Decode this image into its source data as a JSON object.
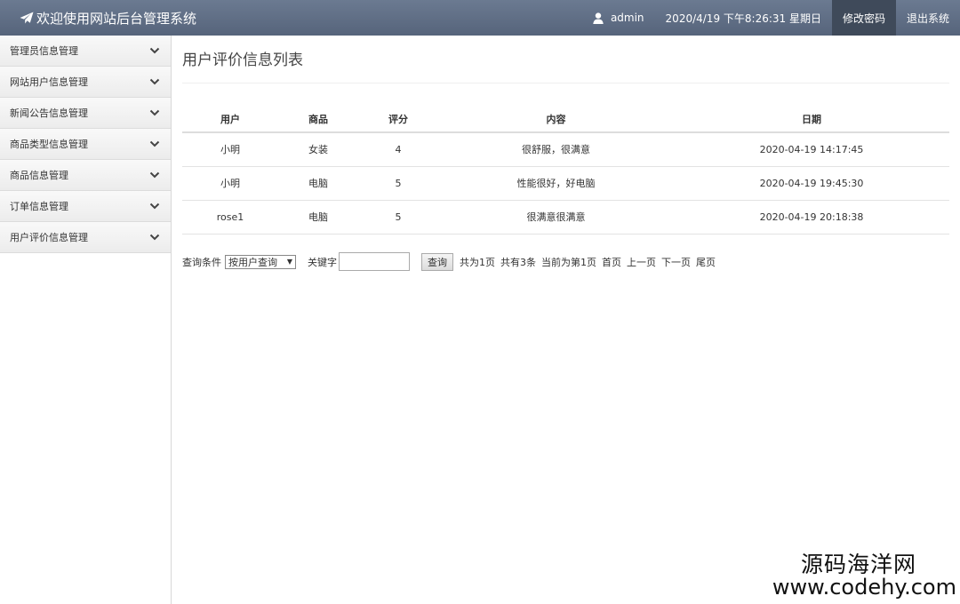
{
  "header": {
    "title": "欢迎使用网站后台管理系统",
    "user": "admin",
    "datetime": "2020/4/19 下午8:26:31 星期日",
    "change_password": "修改密码",
    "logout": "退出系统"
  },
  "sidebar": {
    "items": [
      {
        "label": "管理员信息管理"
      },
      {
        "label": "网站用户信息管理"
      },
      {
        "label": "新闻公告信息管理"
      },
      {
        "label": "商品类型信息管理"
      },
      {
        "label": "商品信息管理"
      },
      {
        "label": "订单信息管理"
      },
      {
        "label": "用户评价信息管理"
      }
    ]
  },
  "main": {
    "title": "用户评价信息列表",
    "columns": [
      "用户",
      "商品",
      "评分",
      "内容",
      "日期"
    ],
    "rows": [
      [
        "小明",
        "女装",
        "4",
        "很舒服，很满意",
        "2020-04-19 14:17:45"
      ],
      [
        "小明",
        "电脑",
        "5",
        "性能很好，好电脑",
        "2020-04-19 19:45:30"
      ],
      [
        "rose1",
        "电脑",
        "5",
        "很满意很满意",
        "2020-04-19 20:18:38"
      ]
    ],
    "search": {
      "condition_label": "查询条件",
      "condition_value": "按用户查询",
      "keyword_label": "关键字",
      "keyword_value": "",
      "query_button": "查询"
    },
    "pagination": {
      "total_pages": "共为1页",
      "total_records": "共有3条",
      "current": "当前为第1页",
      "first": "首页",
      "prev": "上一页",
      "next": "下一页",
      "last": "尾页"
    }
  },
  "watermark": {
    "line1": "源码海洋网",
    "line2": "www.codehy.com"
  }
}
